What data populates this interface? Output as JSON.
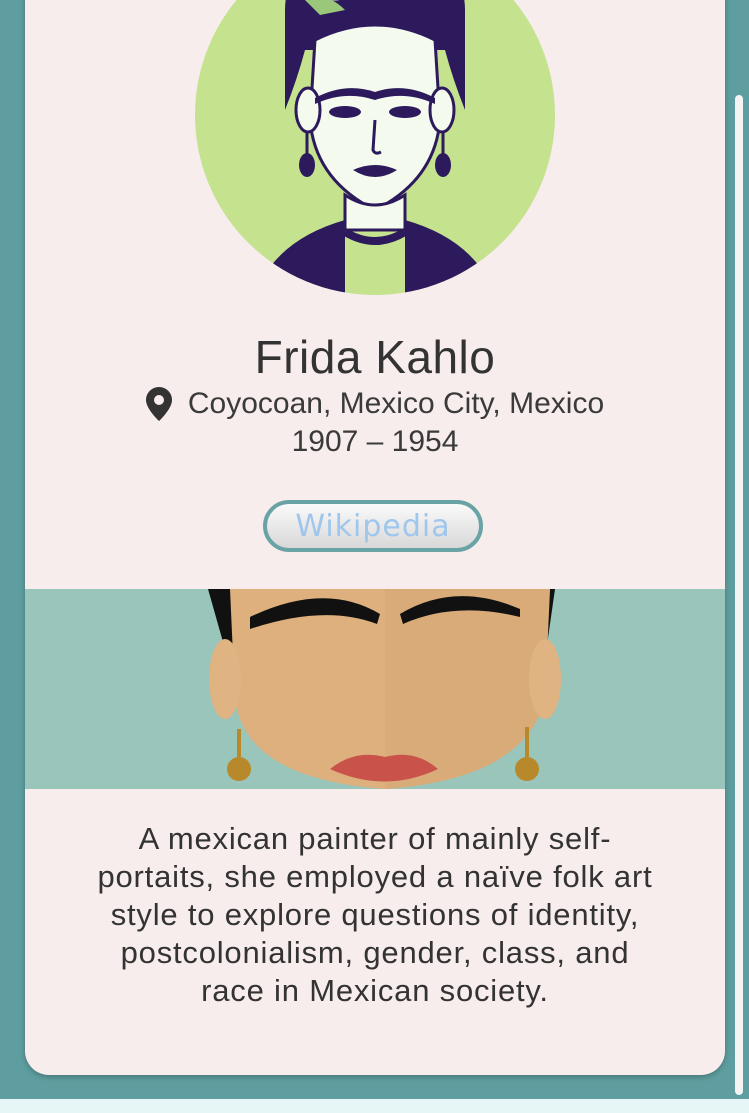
{
  "profile": {
    "name": "Frida Kahlo",
    "location": "Coyocoan, Mexico City, Mexico",
    "years": "1907 – 1954",
    "wiki_label": "Wikipedia",
    "description": "A mexican painter of mainly self-portaits, she employed a naïve folk art style to explore questions of identity, postcolonialism, gender, class, and race in Mexican society."
  },
  "icons": {
    "location": "location-pin-icon"
  },
  "colors": {
    "background": "#5f9ea0",
    "card": "#f8eded",
    "avatar_circle": "#c5e28f",
    "banner": "#9ac5ba",
    "button_border": "#6aa3a6",
    "button_text": "#9fc6ec"
  }
}
